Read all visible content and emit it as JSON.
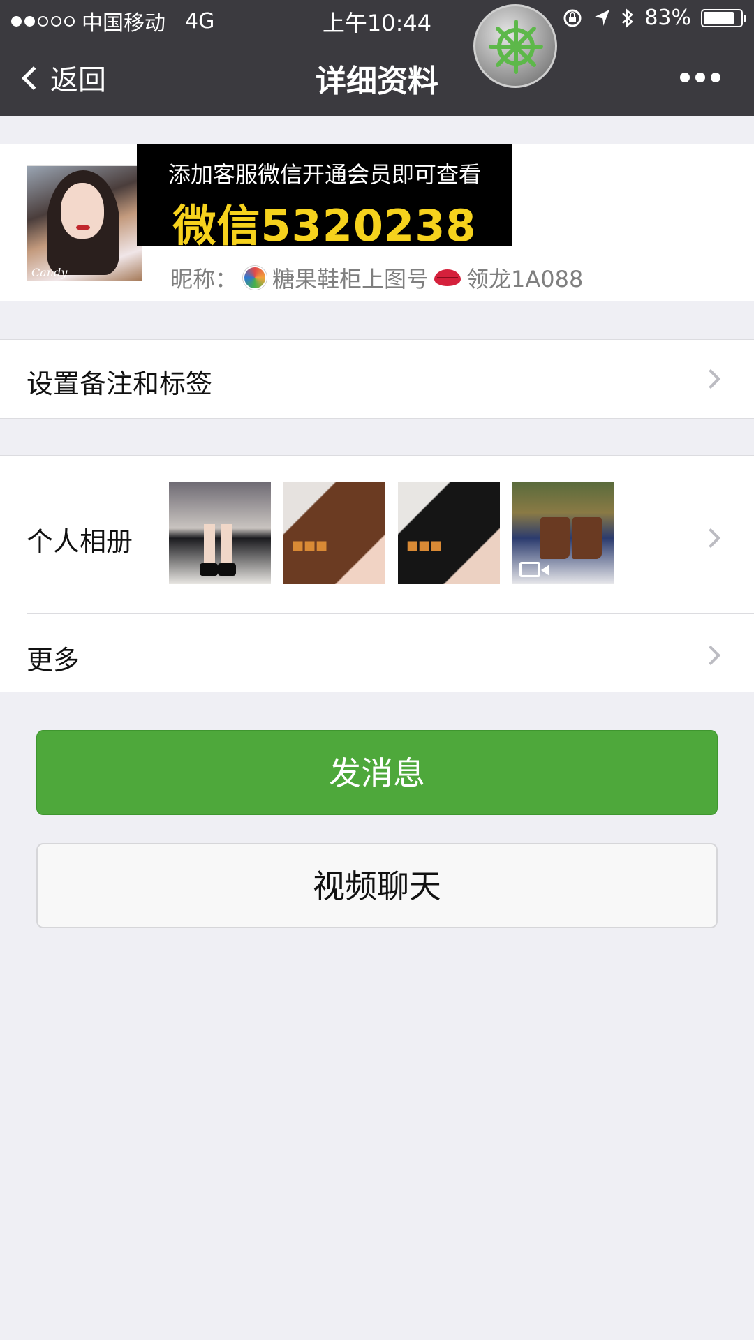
{
  "status_bar": {
    "signal_dots_total": 5,
    "signal_dots_filled": 2,
    "carrier": "中国移动",
    "network": "4G",
    "time": "上午10:44",
    "battery": "83%",
    "battery_level": 0.83
  },
  "nav": {
    "back_label": "返回",
    "title": "详细资料"
  },
  "profile": {
    "avatar_caption": "Candy",
    "promo_line1": "添加客服微信开通会员即可查看",
    "promo_line2": "微信5320238",
    "nickname_label": "昵称：",
    "nickname_part1": "糖果鞋柜上图号",
    "nickname_part2": "领龙1A088"
  },
  "rows": {
    "remark_label": "设置备注和标签",
    "album_label": "个人相册",
    "more_label": "更多"
  },
  "buttons": {
    "send_message": "发消息",
    "video_call": "视频聊天"
  },
  "colors": {
    "nav_bg": "#3b3a3f",
    "accent_green": "#4ea83b",
    "promo_yellow": "#f6d21d",
    "page_bg": "#efeff4"
  }
}
